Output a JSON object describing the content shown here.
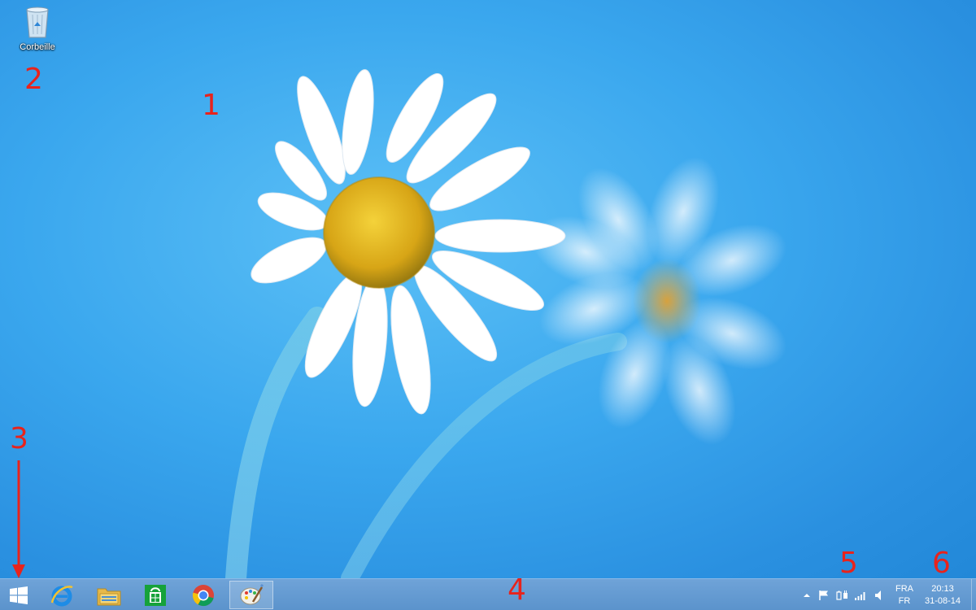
{
  "desktop": {
    "recycle_bin_label": "Corbeille"
  },
  "annotations": {
    "m1": "1",
    "m2": "2",
    "m3": "3",
    "m4": "4",
    "m5": "5",
    "m6": "6"
  },
  "taskbar": {
    "pinned": [
      {
        "name": "internet-explorer",
        "icon": "ie-icon"
      },
      {
        "name": "file-explorer",
        "icon": "folder-icon"
      },
      {
        "name": "windows-store",
        "icon": "store-icon"
      },
      {
        "name": "chrome",
        "icon": "chrome-icon"
      },
      {
        "name": "paint",
        "icon": "paint-icon",
        "active": true
      }
    ],
    "tray": {
      "language_top": "FRA",
      "language_bottom": "FR",
      "time": "20:13",
      "date": "31-08-14"
    }
  },
  "colors": {
    "accent_marker": "#e8231c",
    "taskbar": "#5b93cc",
    "sky": "#3aa7ee"
  }
}
